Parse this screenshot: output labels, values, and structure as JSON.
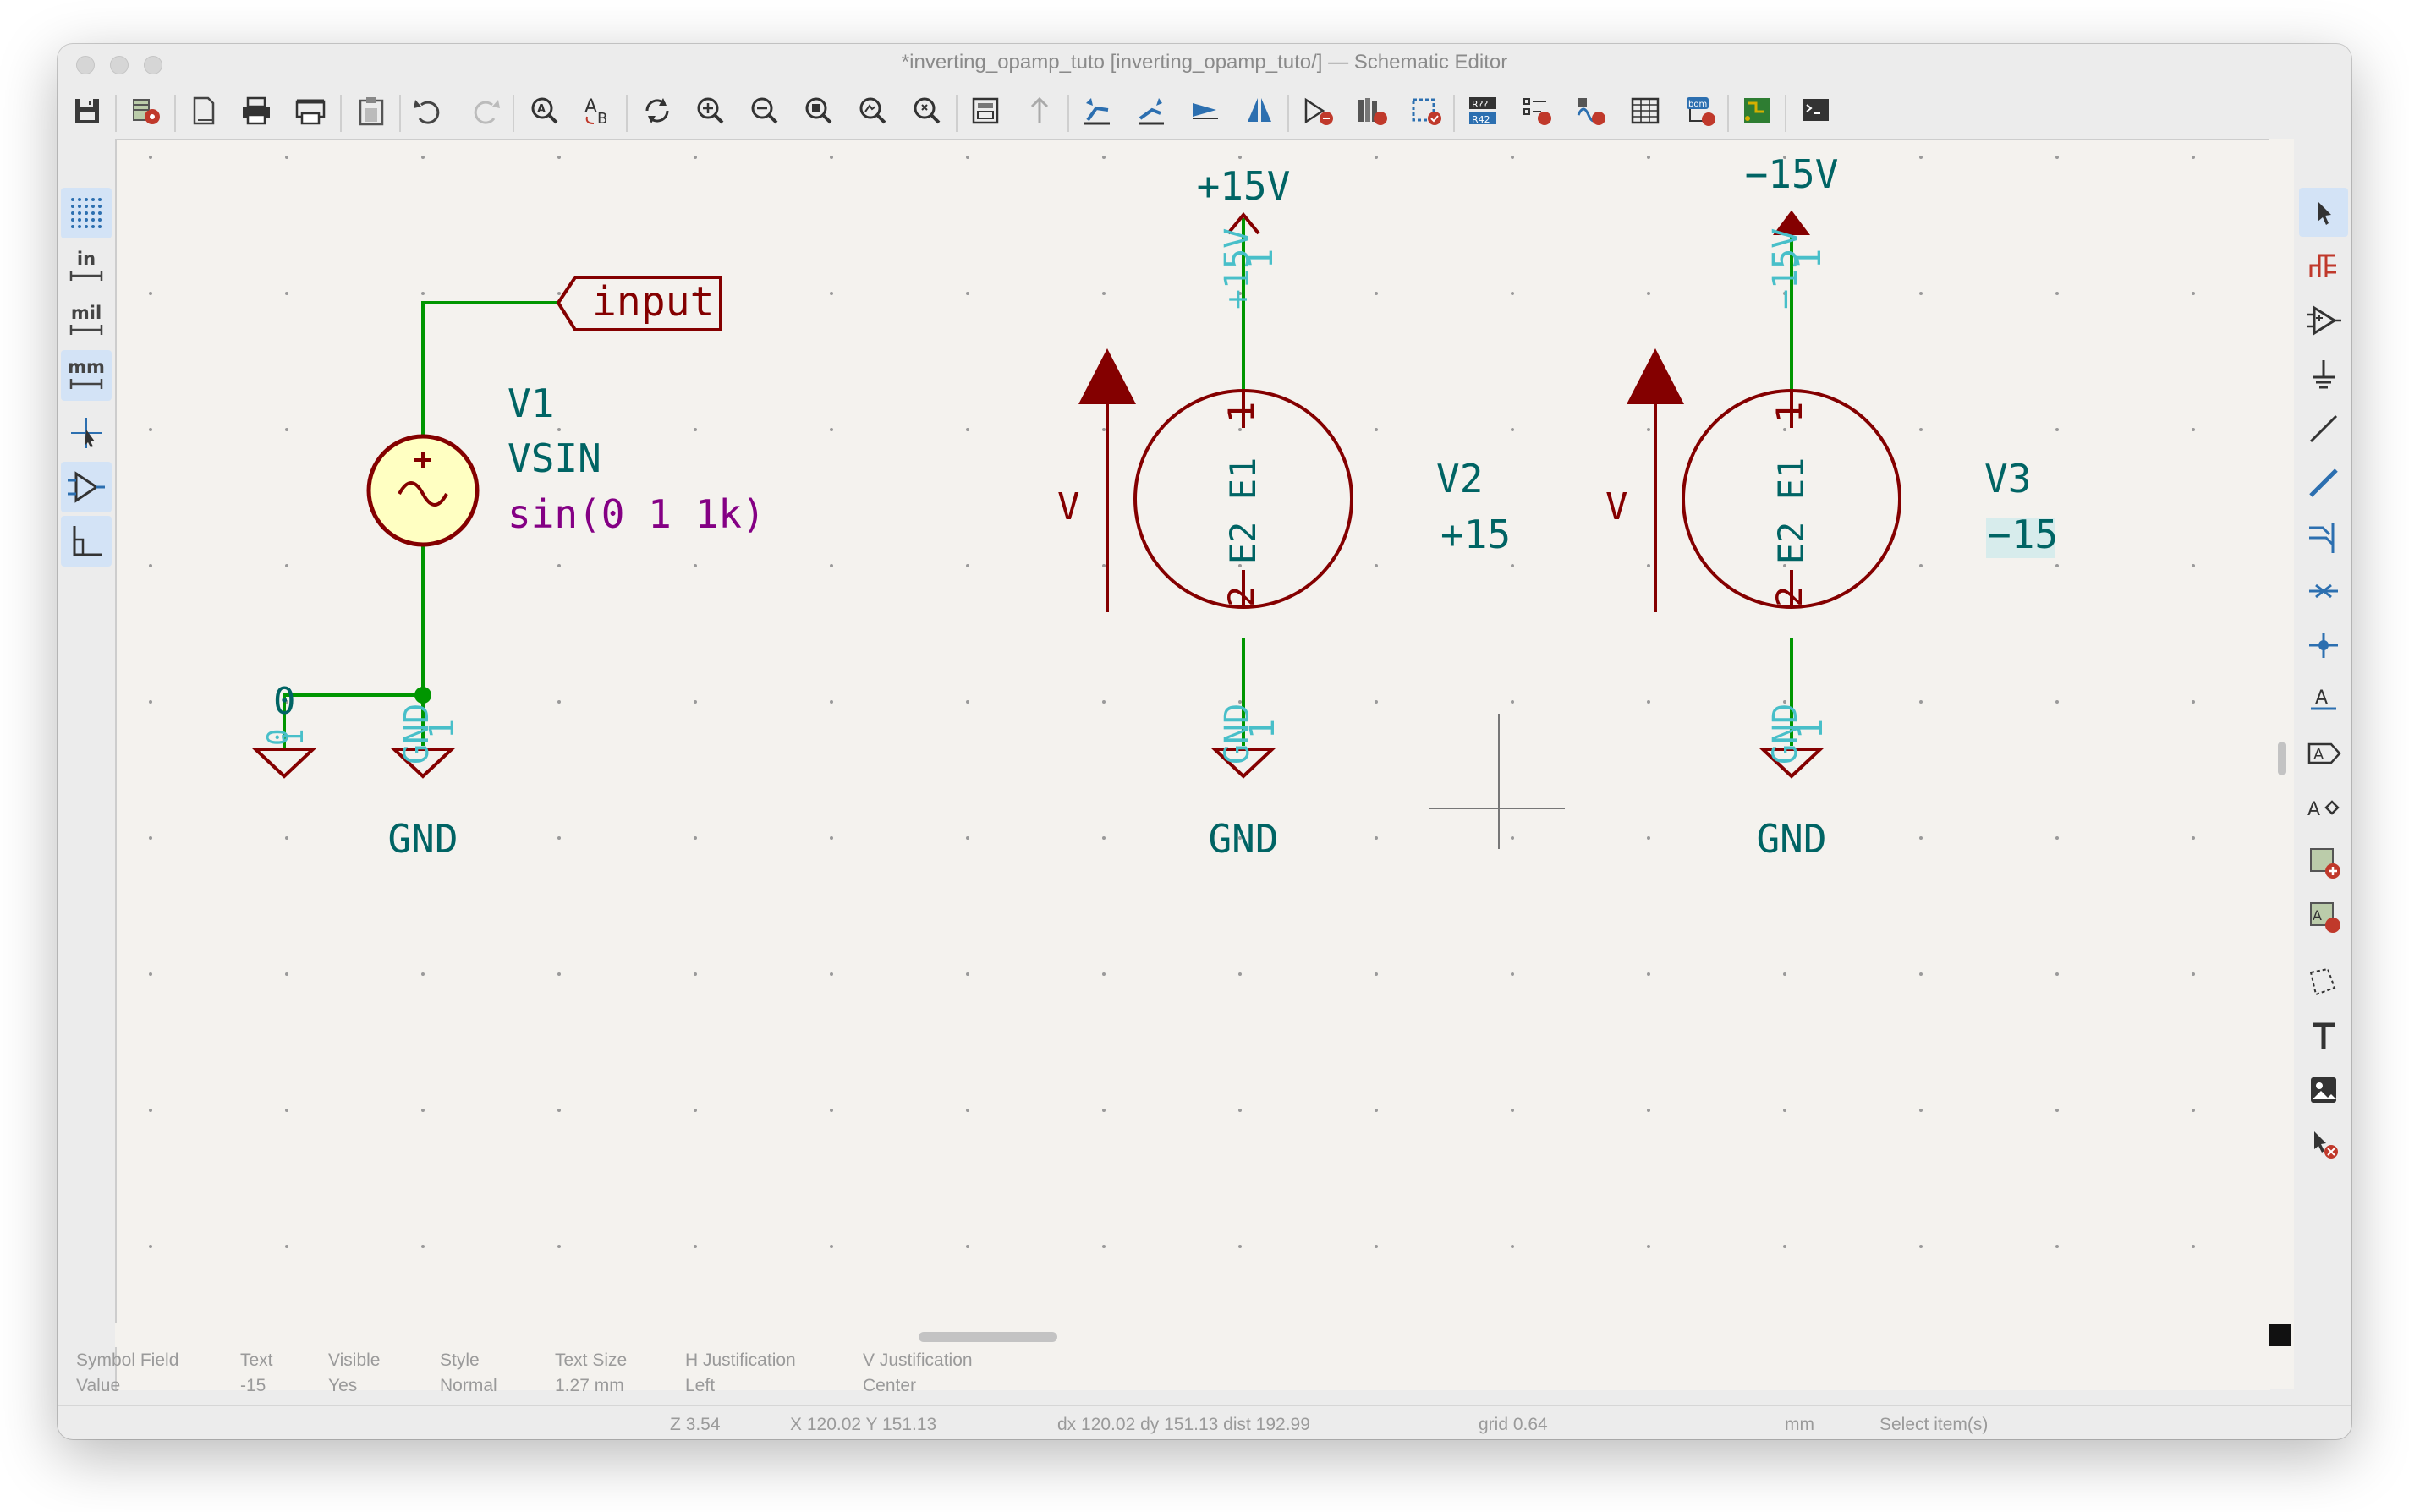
{
  "window": {
    "title": "*inverting_opamp_tuto [inverting_opamp_tuto/] — Schematic Editor"
  },
  "toolbar": {
    "buttons": [
      "save-icon",
      "schematic-setup-icon",
      "page-settings-icon",
      "print-icon",
      "plot-icon",
      "paste-icon",
      "undo-icon",
      "redo-icon",
      "find-icon",
      "find-replace-icon",
      "refresh-icon",
      "zoom-in-icon",
      "zoom-out-icon",
      "zoom-fit-icon",
      "zoom-objects-icon",
      "zoom-selection-icon",
      "hierarchy-navigator-icon",
      "leave-sheet-icon",
      "rotate-ccw-icon",
      "rotate-cw-icon",
      "mirror-vertical-icon",
      "mirror-horizontal-icon",
      "symbol-editor-icon",
      "symbol-library-browser-icon",
      "footprint-assign-icon",
      "annotate-icon",
      "erc-icon",
      "simulator-icon",
      "fields-table-icon",
      "bom-icon",
      "pcb-editor-icon",
      "scripting-console-icon"
    ]
  },
  "left_toolbar": {
    "units": {
      "inch": "in",
      "mil": "mil",
      "mm": "mm"
    }
  },
  "right_toolbar": {
    "buttons": [
      "select-arrow-icon",
      "highlight-net-icon",
      "add-symbol-icon",
      "add-power-icon",
      "add-wire-icon",
      "add-bus-icon",
      "add-wire-to-bus-entry-icon",
      "add-no-connect-icon",
      "add-junction-icon",
      "add-label-icon",
      "add-global-label-icon",
      "add-hierarchical-label-icon",
      "add-sheet-icon",
      "import-sheet-pin-icon",
      "add-graphic-lines-icon",
      "add-text-icon",
      "add-image-icon",
      "delete-tool-icon"
    ]
  },
  "schematic": {
    "colors": {
      "symbol": "#840000",
      "wire": "#009600",
      "ref_text": "#006464",
      "pin_text": "#48bfc9",
      "value_purple": "#840084",
      "source_fill": "#ffffc2"
    },
    "input_label": "input",
    "v1": {
      "ref": "V1",
      "value": "VSIN",
      "param": "sin(0 1 1k)"
    },
    "v2": {
      "ref": "V2",
      "value": "+15",
      "pin1": "E1",
      "pin2": "E2",
      "arrow_label": "V",
      "pin_num1": "1",
      "pin_num2": "2"
    },
    "v3": {
      "ref": "V3",
      "value": "−15",
      "pin1": "E1",
      "pin2": "E2",
      "arrow_label": "V",
      "pin_num1": "1",
      "pin_num2": "2"
    },
    "pwr_pos": {
      "value": "+15V",
      "pin_name": "+15V",
      "pin_num": "1"
    },
    "pwr_neg": {
      "value": "−15V",
      "pin_name": "−15V",
      "pin_num": "1"
    },
    "gnd1": {
      "value": "GND",
      "pin_name": "GND",
      "pin_num": "1"
    },
    "gnd2": {
      "value": "GND",
      "pin_name": "GND",
      "pin_num": "1"
    },
    "gnd3": {
      "value": "GND",
      "pin_name": "GND",
      "pin_num": "1"
    },
    "sim_ground": {
      "value": "0",
      "pin_name": "0",
      "pin_num": "1"
    }
  },
  "properties": {
    "symbol_field": {
      "key": "Symbol Field",
      "value": "Value"
    },
    "text": {
      "key": "Text",
      "value": "-15"
    },
    "visible": {
      "key": "Visible",
      "value": "Yes"
    },
    "style": {
      "key": "Style",
      "value": "Normal"
    },
    "text_size": {
      "key": "Text Size",
      "value": "1.27 mm"
    },
    "h_just": {
      "key": "H Justification",
      "value": "Left"
    },
    "v_just": {
      "key": "V Justification",
      "value": "Center"
    }
  },
  "status": {
    "zoom": "Z 3.54",
    "cursor": "X 120.02  Y 151.13",
    "delta": "dx 120.02  dy 151.13  dist 192.99",
    "grid": "grid 0.64",
    "units": "mm",
    "mode": "Select item(s)"
  }
}
